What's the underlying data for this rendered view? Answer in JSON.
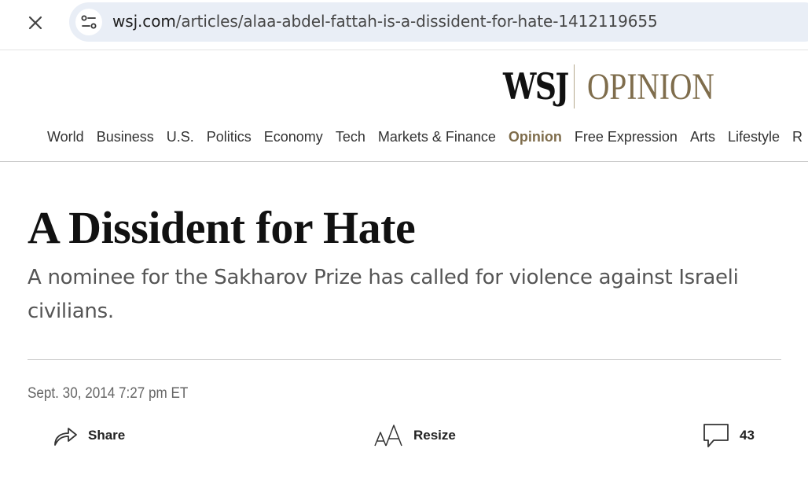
{
  "browser": {
    "url_domain": "wsj.com",
    "url_path": "/articles/alaa-abdel-fattah-is-a-dissident-for-hate-1412119655"
  },
  "masthead": {
    "brand": "WSJ",
    "section": "OPINION"
  },
  "nav": {
    "items": [
      "World",
      "Business",
      "U.S.",
      "Politics",
      "Economy",
      "Tech",
      "Markets & Finance",
      "Opinion",
      "Free Expression",
      "Arts",
      "Lifestyle",
      "R"
    ],
    "active": "Opinion"
  },
  "article": {
    "headline": "A Dissident for Hate",
    "dek": "A nominee for the Sakharov Prize has called for violence against Israeli civilians.",
    "dateline": "Sept. 30, 2014 7:27 pm ET"
  },
  "tools": {
    "share_label": "Share",
    "resize_label": "Resize",
    "comments_count": "43"
  },
  "colors": {
    "opinion_accent": "#7f6d4c",
    "url_pill": "#e9eef6"
  }
}
